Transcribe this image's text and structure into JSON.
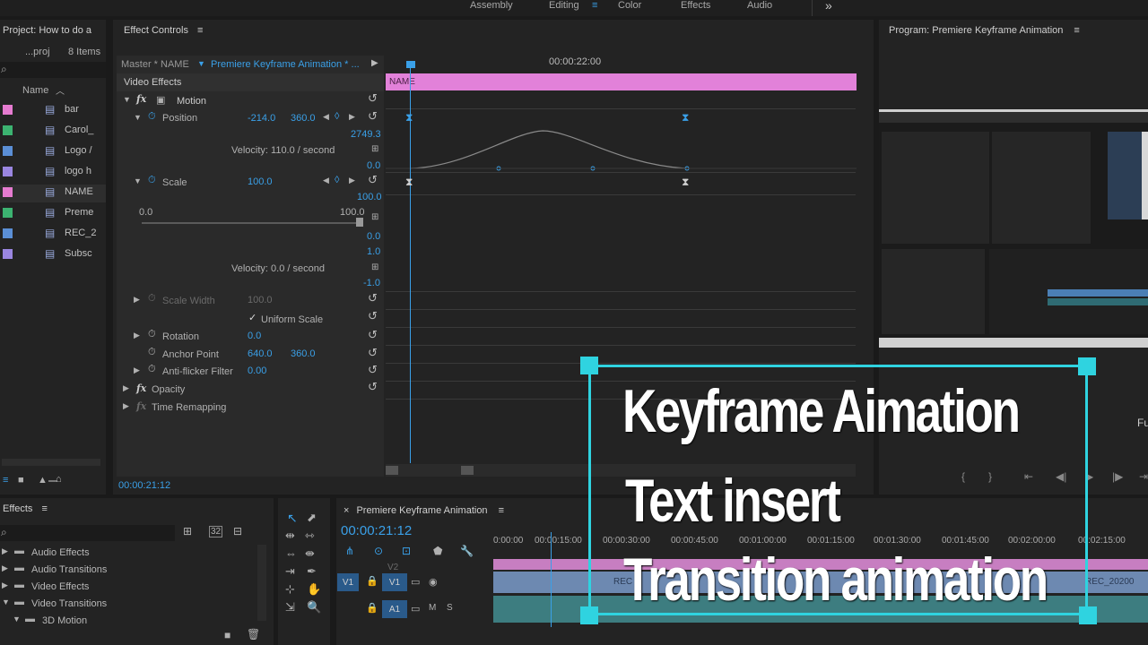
{
  "workspaces": {
    "tabs": [
      "Assembly",
      "Editing",
      "Color",
      "Effects",
      "Audio"
    ],
    "active": "Editing",
    "more": "»"
  },
  "project": {
    "title": "Project: How to do a",
    "file": "...proj",
    "count": "8 Items",
    "name_header": "Name",
    "items": [
      {
        "label": "bar",
        "color": "#e57bd0",
        "icon": "sequence-icon"
      },
      {
        "label": "Carol_",
        "color": "#3cb371",
        "icon": "video-clip-icon"
      },
      {
        "label": "Logo /",
        "color": "#5b8fd6",
        "icon": "image-icon"
      },
      {
        "label": "logo h",
        "color": "#9a86e0",
        "icon": "image-icon"
      },
      {
        "label": "NAME",
        "color": "#e57bd0",
        "icon": "title-icon"
      },
      {
        "label": "Preme",
        "color": "#3cb371",
        "icon": "sequence-icon"
      },
      {
        "label": "REC_2",
        "color": "#5b8fd6",
        "icon": "video-clip-icon"
      },
      {
        "label": "Subsc",
        "color": "#9a86e0",
        "icon": "image-icon"
      }
    ]
  },
  "effect_controls": {
    "title": "Effect Controls",
    "master": "Master * NAME",
    "clip": "Premiere Keyframe Animation * ...",
    "timecode_top": "00:00:22:00",
    "clip_bar_label": "NAME",
    "video_effects": "Video Effects",
    "motion": "Motion",
    "position_label": "Position",
    "position_x": "-214.0",
    "position_y": "360.0",
    "pos_max": "2749.3",
    "pos_zero": "0.0",
    "velocity1": "Velocity: 110.0 / second",
    "scale_label": "Scale",
    "scale_value": "100.0",
    "scale_max": "100.0",
    "scale_min_label": "0.0",
    "scale_max_label": "100.0",
    "scale_zero": "0.0",
    "scale_one": "1.0",
    "scale_neg": "-1.0",
    "velocity2": "Velocity: 0.0 / second",
    "scale_width_label": "Scale Width",
    "scale_width_value": "100.0",
    "uniform_scale": "Uniform Scale",
    "rotation_label": "Rotation",
    "rotation_value": "0.0",
    "anchor_label": "Anchor Point",
    "anchor_x": "640.0",
    "anchor_y": "360.0",
    "antiflicker_label": "Anti-flicker Filter",
    "antiflicker_value": "0.00",
    "opacity": "Opacity",
    "time_remap": "Time Remapping",
    "timecode_bottom": "00:00:21:12"
  },
  "program": {
    "title": "Program: Premiere Keyframe Animation",
    "partial_text": "Fu"
  },
  "effects_panel": {
    "title": "Effects",
    "items": [
      "Audio Effects",
      "Audio Transitions",
      "Video Effects",
      "Video Transitions",
      "3D Motion"
    ]
  },
  "timeline": {
    "title": "Premiere Keyframe Animation",
    "timecode": "00:00:21:12",
    "ruler": [
      "0:00:00",
      "00:00:15:00",
      "00:00:30:00",
      "00:00:45:00",
      "00:01:00:00",
      "00:01:15:00",
      "00:01:30:00",
      "00:01:45:00",
      "00:02:00:00",
      "00:02:15:00"
    ],
    "tracks": {
      "v2": "V2",
      "v1": "V1",
      "a1": "A1",
      "m": "M",
      "s": "S"
    },
    "clip_labels": [
      "REC",
      "REC_20200"
    ]
  },
  "overlay": {
    "line1": "Keyframe Aimation",
    "line2": "Text insert",
    "line3": "Transition animation",
    "frame_color": "#2fd3e0"
  }
}
